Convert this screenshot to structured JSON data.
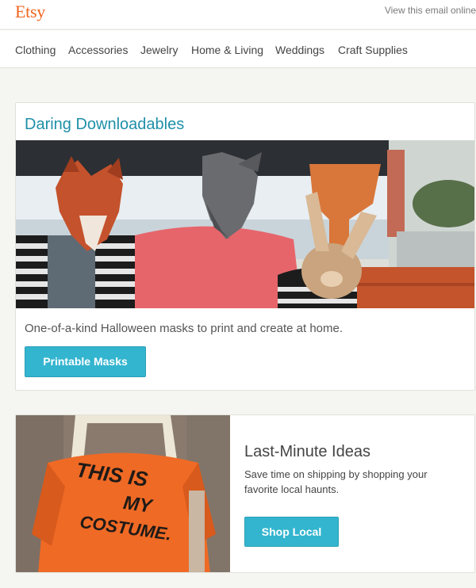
{
  "header": {
    "logo": "Etsy",
    "view_online": "View this email online"
  },
  "nav": {
    "items": [
      "Clothing",
      "Accessories",
      "Jewelry",
      "Home & Living",
      "Weddings",
      "Craft Supplies"
    ]
  },
  "feature": {
    "title": "Daring Downloadables",
    "description": "One-of-a-kind Halloween masks to print and create at home.",
    "button": "Printable Masks"
  },
  "promo": {
    "title": "Last-Minute Ideas",
    "description": "Save time on shipping by shopping your favorite local haunts.",
    "button": "Shop Local",
    "shirt_text": [
      "THIS IS",
      "MY",
      "COSTUME."
    ]
  },
  "colors": {
    "brand": "#f1641e",
    "accent_title": "#1f90a8",
    "button": "#33b5cf",
    "background": "#f5f5f1"
  }
}
